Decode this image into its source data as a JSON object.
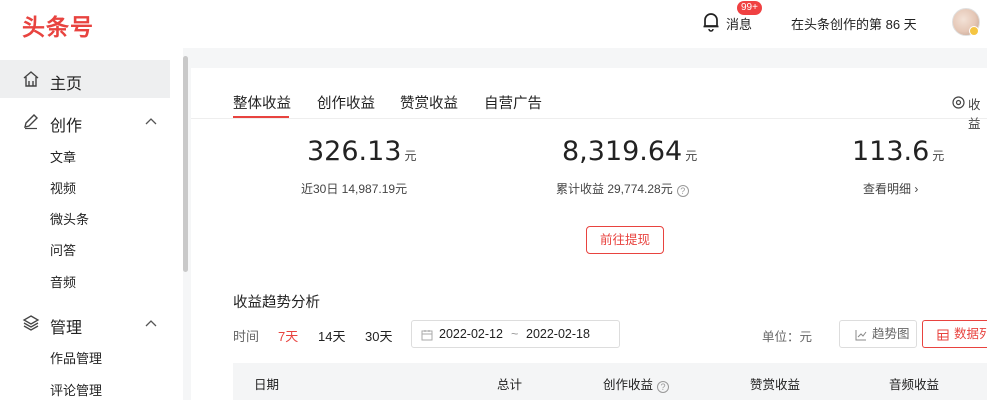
{
  "header": {
    "logo": "头条号",
    "message_label": "消息",
    "message_badge": "99+",
    "creator_days": "在头条创作的第 86 天"
  },
  "sidebar": {
    "home": "主页",
    "create": "创作",
    "create_items": [
      "文章",
      "视频",
      "微头条",
      "问答",
      "音频"
    ],
    "manage": "管理",
    "manage_items": [
      "作品管理",
      "评论管理"
    ]
  },
  "tabs": [
    "整体收益",
    "创作收益",
    "赞赏收益",
    "自营广告"
  ],
  "settlement_label": "收益",
  "stats": [
    {
      "value": "326.13",
      "unit": "元",
      "sub": "近30日 14,987.19元"
    },
    {
      "value": "8,319.64",
      "unit": "元",
      "sub": "累计收益 29,774.28元"
    },
    {
      "value": "113.6",
      "unit": "元",
      "sub": "查看明细 ›"
    }
  ],
  "withdraw_button": "前往提现",
  "trend": {
    "title": "收益趋势分析",
    "time_label": "时间",
    "ranges": [
      "7天",
      "14天",
      "30天"
    ],
    "date_start": "2022-02-12",
    "date_sep": "~",
    "date_end": "2022-02-18",
    "unit_label": "单位：元",
    "view_chart": "趋势图",
    "view_list": "数据列"
  },
  "table": {
    "columns": [
      "日期",
      "总计",
      "创作收益",
      "赞赏收益",
      "音频收益"
    ]
  },
  "colors": {
    "accent": "#e8433f"
  }
}
